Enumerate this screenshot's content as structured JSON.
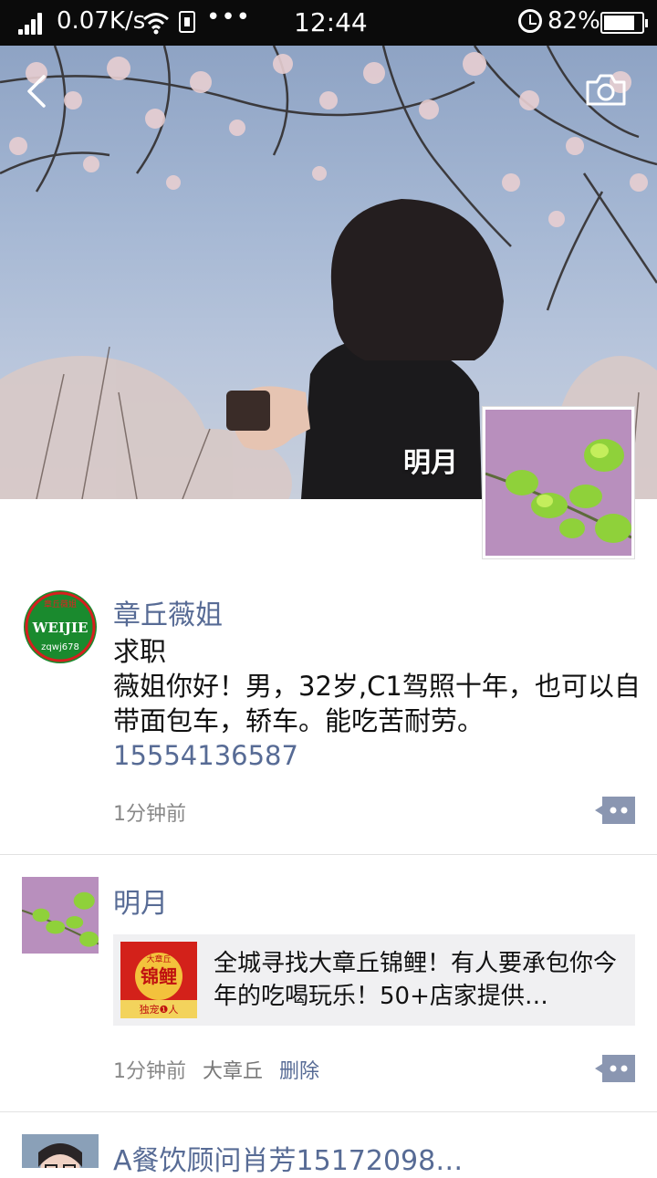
{
  "status_bar": {
    "speed": "0.07K/s",
    "dots": "•••",
    "time": "12:44",
    "battery_pct": "82%",
    "battery_level": 0.82
  },
  "cover": {
    "name": "明月"
  },
  "posts": [
    {
      "author": "章丘薇姐",
      "avatar_lines": [
        "章丘薇姐",
        "WEIJIE",
        "zqwj678"
      ],
      "text": "求职\n薇姐你好！男，32岁,C1驾照十年，也可以自带面包车，轿车。能吃苦耐劳。",
      "phone": "15554136587",
      "time": "1分钟前"
    },
    {
      "author": "明月",
      "share_title": "全城寻找大章丘锦鲤！有人要承包你今年的吃喝玩乐！50+店家提供…",
      "share_thumb_lines": [
        "大章丘",
        "锦鲤",
        "独宠❶人"
      ],
      "time": "1分钟前",
      "location": "大章丘",
      "delete_label": "删除"
    },
    {
      "author": "A餐饮顾问肖芳15172098…"
    }
  ]
}
